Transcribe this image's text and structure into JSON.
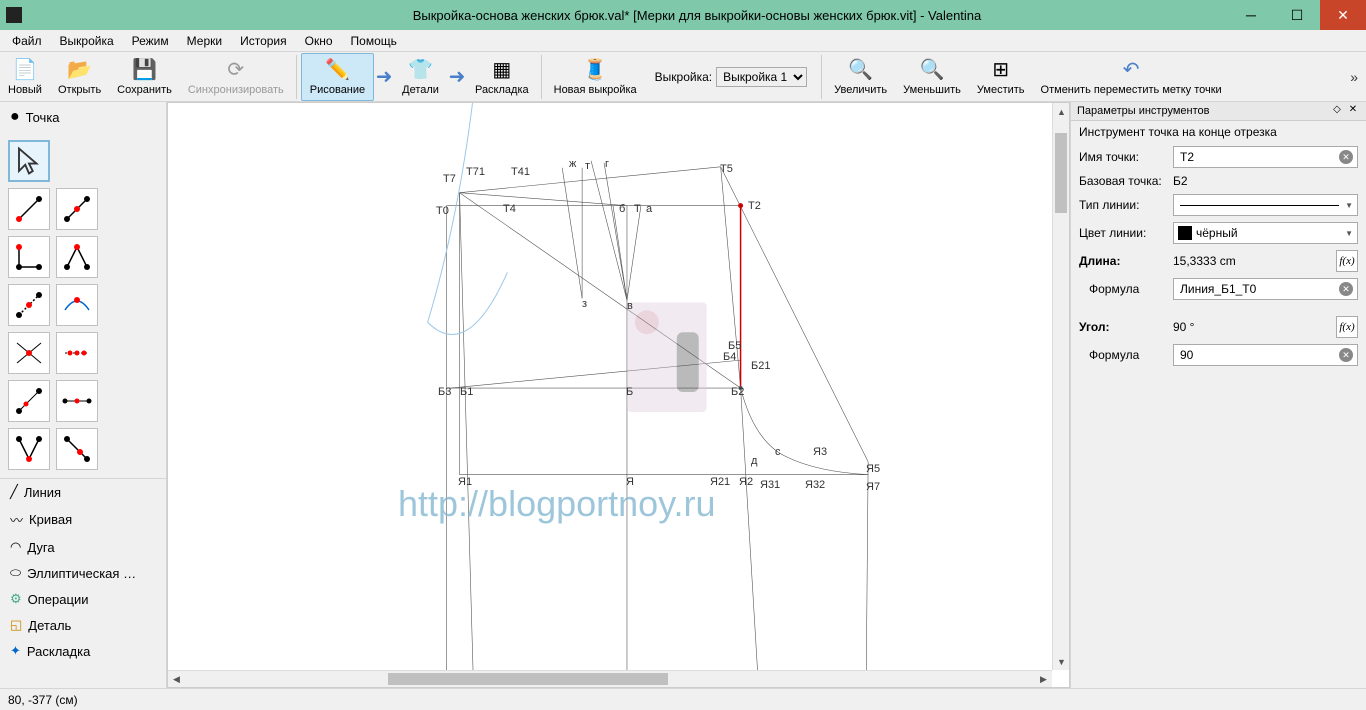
{
  "window": {
    "title": "Выкройка-основа женских брюк.val* [Мерки для выкройки-основы женских брюк.vit] - Valentina"
  },
  "menu": [
    "Файл",
    "Выкройка",
    "Режим",
    "Мерки",
    "История",
    "Окно",
    "Помощь"
  ],
  "toolbar": {
    "new": "Новый",
    "open": "Открыть",
    "save": "Сохранить",
    "sync": "Синхронизировать",
    "draw": "Рисование",
    "details": "Детали",
    "layout": "Раскладка",
    "newpattern": "Новая выкройка",
    "pattern_label": "Выкройка:",
    "pattern_value": "Выкройка 1",
    "zoomin": "Увеличить",
    "zoomout": "Уменьшить",
    "fit": "Уместить",
    "undo_move": "Отменить переместить метку точки"
  },
  "left": {
    "point": "Точка",
    "line": "Линия",
    "curve": "Кривая",
    "arc": "Дуга",
    "elliptical": "Эллиптическая …",
    "operations": "Операции",
    "detail": "Деталь",
    "layout": "Раскладка"
  },
  "props": {
    "title": "Параметры инструментов",
    "tool_name": "Инструмент точка на конце отрезка",
    "point_name_label": "Имя точки:",
    "point_name": "Т2",
    "base_point_label": "Базовая точка:",
    "base_point": "Б2",
    "line_type_label": "Тип линии:",
    "line_color_label": "Цвет линии:",
    "line_color": "чёрный",
    "length_label": "Длина:",
    "length": "15,3333 cm",
    "formula_label": "Формула",
    "formula_length": "Линия_Б1_Т0",
    "angle_label": "Угол:",
    "angle": "90 °",
    "formula_angle": "90"
  },
  "canvas": {
    "watermark": "http://blogportnoy.ru",
    "labels": [
      "Т7",
      "Т71",
      "Т41",
      "ж",
      "т",
      "г",
      "Т5",
      "Т0",
      "Т4",
      "б",
      "Т",
      "а",
      "Т2",
      "з",
      "в",
      "Б4",
      "Б5",
      "Б21",
      "Б3",
      "Б1",
      "Б",
      "Б2",
      "д",
      "с",
      "Я3",
      "Я1",
      "Я",
      "Я21",
      "Я2",
      "Я31",
      "Я32",
      "Я5",
      "Я7"
    ]
  },
  "status": {
    "coords": "80, -377 (см)"
  }
}
